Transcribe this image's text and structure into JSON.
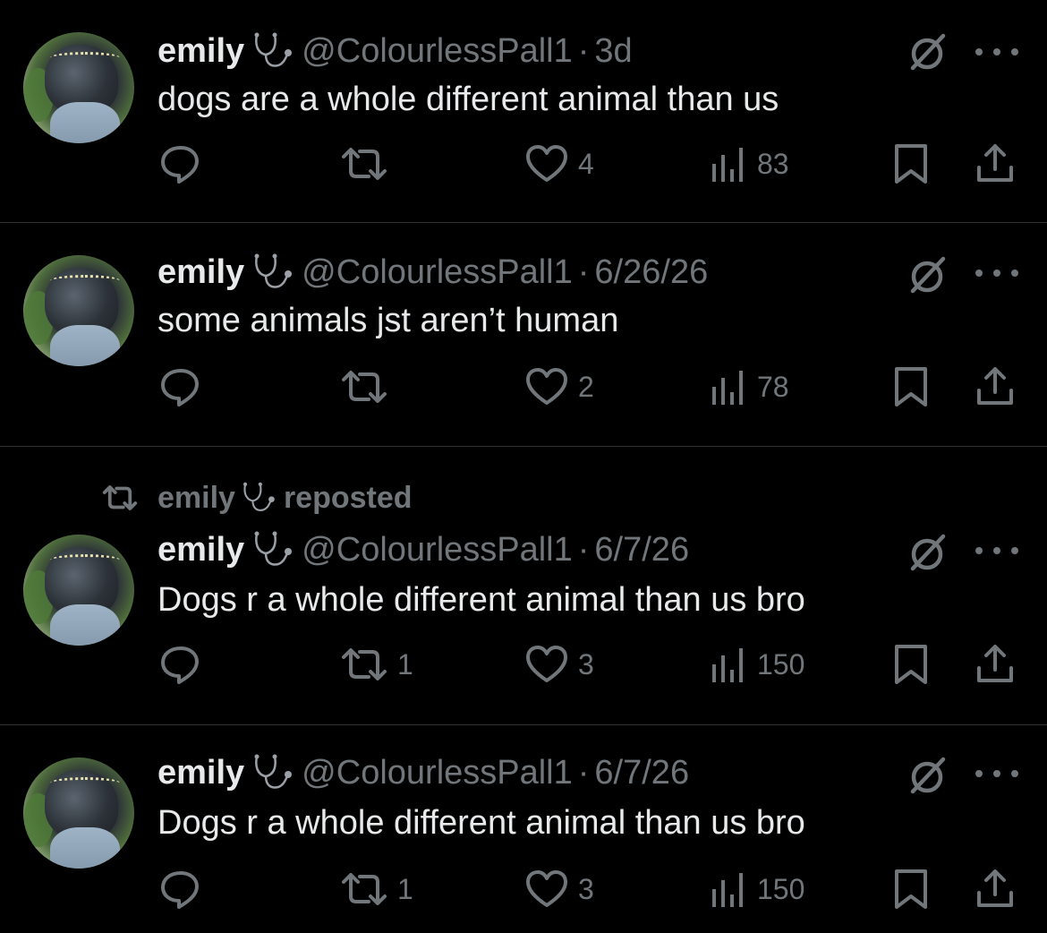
{
  "colors": {
    "background": "#000000",
    "text_primary": "#e7e9ea",
    "text_secondary": "#71767b",
    "divider": "#2f3336"
  },
  "icons": {
    "badge": "stethoscope-icon",
    "grok": "grok-icon",
    "more": "more-icon",
    "reply": "reply-icon",
    "repost": "repost-icon",
    "like": "heart-icon",
    "views": "views-icon",
    "bookmark": "bookmark-icon",
    "share": "share-icon"
  },
  "tweets": [
    {
      "name": "emily",
      "handle": "@ColourlessPall1",
      "separator": "·",
      "time": "3d",
      "text": "dogs are a whole different animal than us",
      "reposts": "",
      "likes": "4",
      "views": "83"
    },
    {
      "name": "emily",
      "handle": "@ColourlessPall1",
      "separator": "·",
      "time": "6/26/26",
      "text": "some animals jst aren’t human",
      "reposts": "",
      "likes": "2",
      "views": "78"
    },
    {
      "repost_by": "emily",
      "repost_label": "reposted",
      "name": "emily",
      "handle": "@ColourlessPall1",
      "separator": "·",
      "time": "6/7/26",
      "text": "Dogs r a whole different animal than us bro",
      "reposts": "1",
      "likes": "3",
      "views": "150"
    },
    {
      "name": "emily",
      "handle": "@ColourlessPall1",
      "separator": "·",
      "time": "6/7/26",
      "text": "Dogs r a whole different animal than us bro",
      "reposts": "1",
      "likes": "3",
      "views": "150"
    }
  ]
}
